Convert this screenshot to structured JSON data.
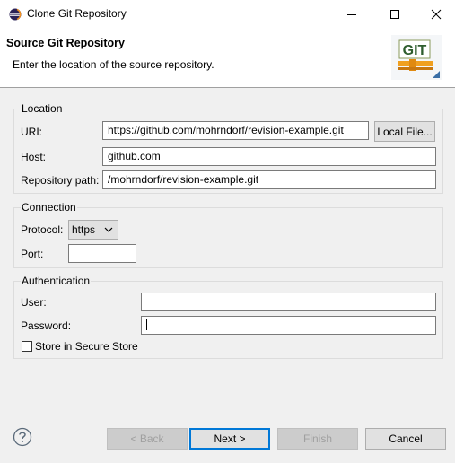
{
  "window": {
    "title": "Clone Git Repository",
    "minimize_icon": "minimize-icon",
    "maximize_icon": "maximize-icon",
    "close_icon": "close-icon"
  },
  "banner": {
    "title": "Source Git Repository",
    "description": "Enter the location of the source repository.",
    "logo_text": "GIT"
  },
  "location": {
    "group_label": "Location",
    "uri_label": "URI:",
    "uri_value": "https://github.com/mohrndorf/revision-example.git",
    "local_file_button": "Local File...",
    "host_label": "Host:",
    "host_value": "github.com",
    "repo_path_label": "Repository path:",
    "repo_path_value": "/mohrndorf/revision-example.git"
  },
  "connection": {
    "group_label": "Connection",
    "protocol_label": "Protocol:",
    "protocol_value": "https",
    "port_label": "Port:",
    "port_value": ""
  },
  "authentication": {
    "group_label": "Authentication",
    "user_label": "User:",
    "user_value": "",
    "password_label": "Password:",
    "password_value": "",
    "store_label": "Store in Secure Store",
    "store_checked": false
  },
  "footer": {
    "help_icon": "help-icon",
    "back_button": "< Back",
    "next_button": "Next >",
    "finish_button": "Finish",
    "cancel_button": "Cancel"
  },
  "colors": {
    "accent": "#0078d7",
    "background": "#f0f0f0",
    "logo_green": "#2e7d32",
    "logo_orange": "#f0a020"
  }
}
